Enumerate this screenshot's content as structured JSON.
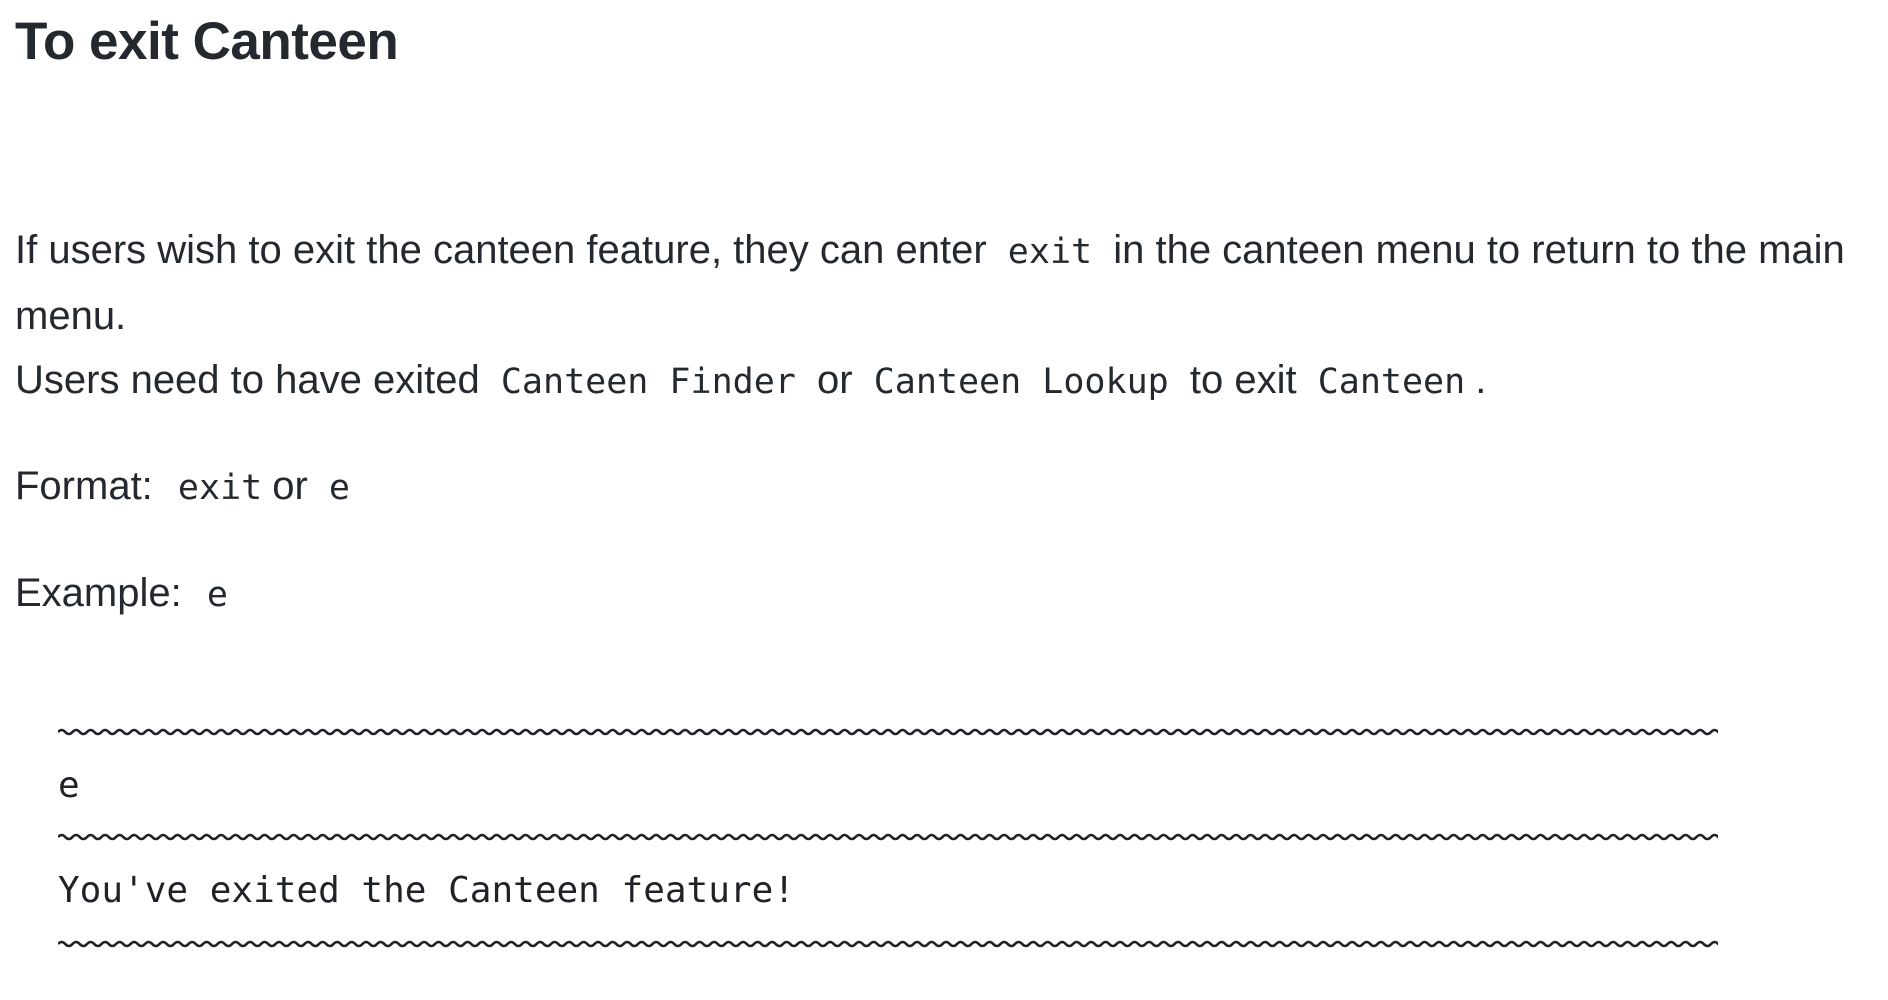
{
  "heading": "To exit Canteen",
  "intro": {
    "t1": "If users wish to exit the canteen feature, they can enter",
    "c1": "exit",
    "t2": "in the canteen menu to return to the main menu.",
    "t3": "Users need to have exited",
    "c2": "Canteen Finder",
    "t4": "or",
    "c3": "Canteen Lookup",
    "t5": "to exit",
    "c4": "Canteen",
    "t6": "."
  },
  "format": {
    "label": "Format:",
    "c1": "exit",
    "or": "or",
    "c2": "e"
  },
  "example": {
    "label": "Example:",
    "code": "e"
  },
  "terminal": {
    "input": "e",
    "output": "You've exited the Canteen feature!"
  }
}
